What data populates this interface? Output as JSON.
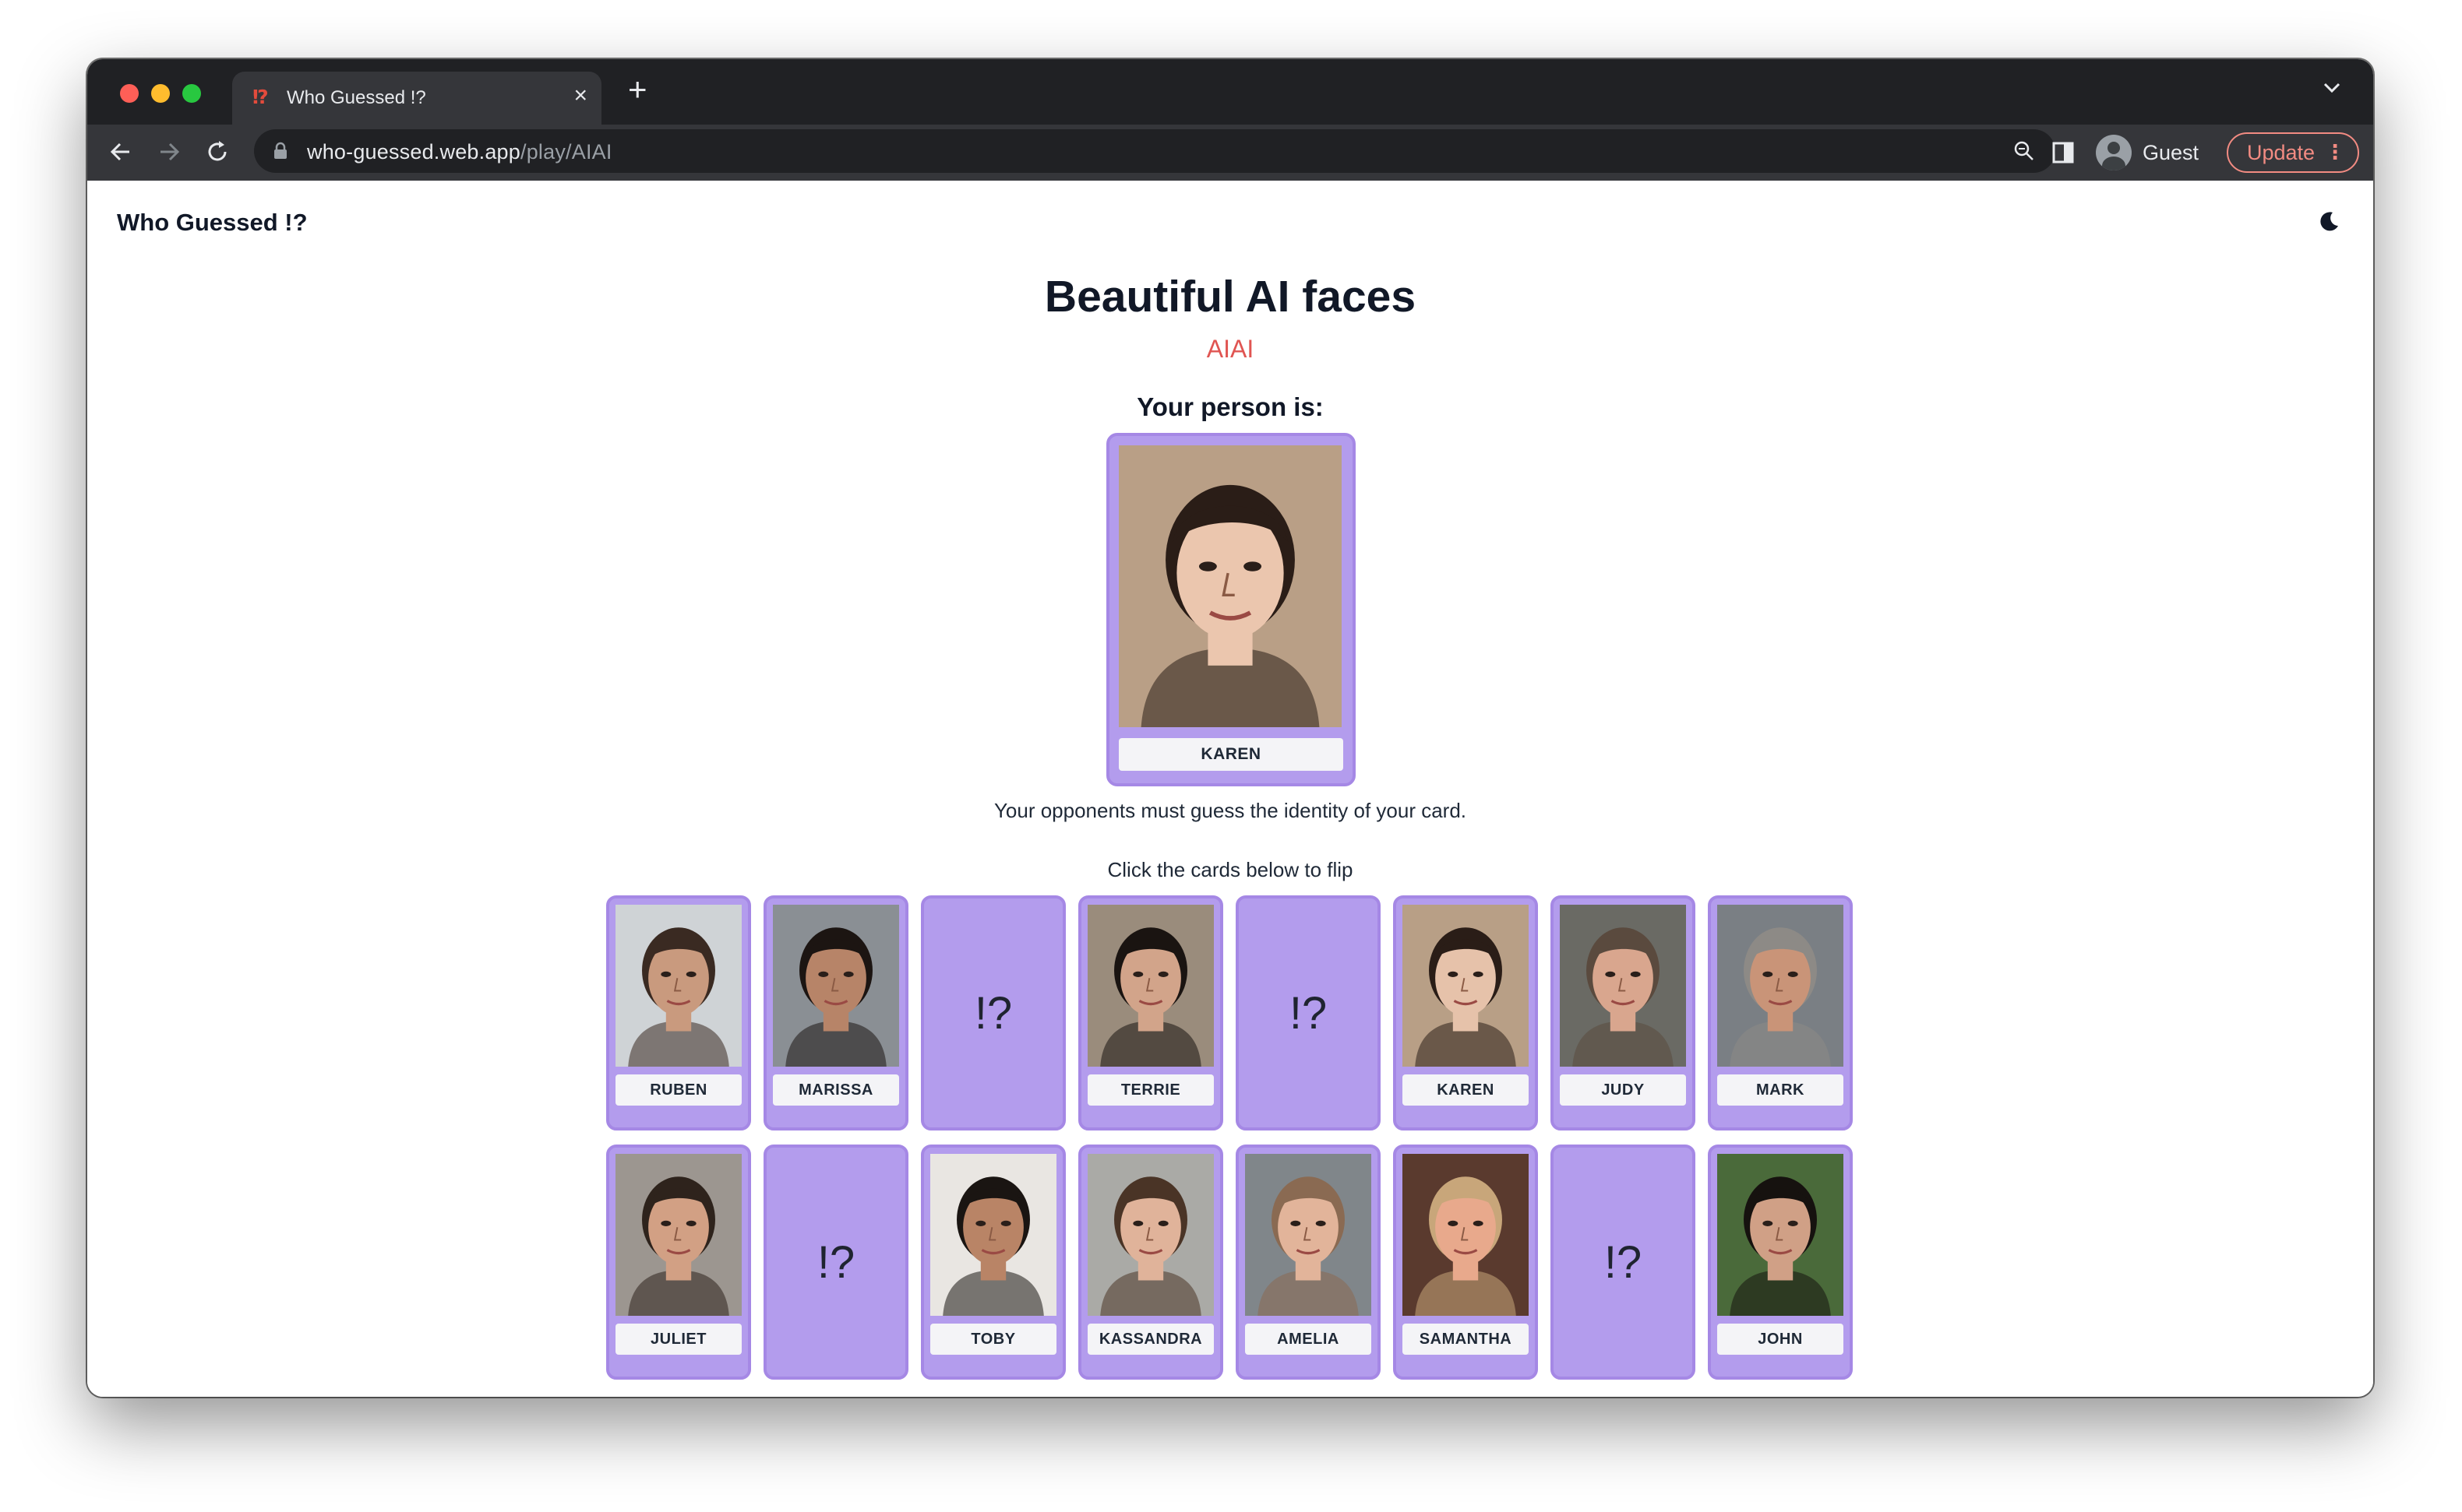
{
  "browser": {
    "tab_title": "Who Guessed !?",
    "tab_favicon": "⁉",
    "url_host": "who-guessed.web.app",
    "url_path": "/play/AIAI",
    "profile_label": "Guest",
    "update_label": "Update"
  },
  "header": {
    "brand": "Who Guessed !?",
    "theme_toggle_icon": "moon-icon"
  },
  "deck": {
    "title": "Beautiful AI faces",
    "code": "AIAI",
    "person_label": "Your person is:",
    "selected_name": "KAREN",
    "hint": "Your opponents must guess the identity of your card.",
    "instruction": "Click the cards below to flip",
    "back_mark": "!?"
  },
  "cards": [
    {
      "name": "RUBEN",
      "flipped": false,
      "skin": "#c99a7e",
      "hair": "#3a2a22",
      "bg": "#cfd3d6"
    },
    {
      "name": "MARISSA",
      "flipped": false,
      "skin": "#b78468",
      "hair": "#1c1512",
      "bg": "#8a8f94"
    },
    {
      "name": "",
      "flipped": true
    },
    {
      "name": "TERRIE",
      "flipped": false,
      "skin": "#d2a48a",
      "hair": "#1a1411",
      "bg": "#9a8c7c"
    },
    {
      "name": "",
      "flipped": true
    },
    {
      "name": "KAREN",
      "flipped": false,
      "skin": "#e6c2aa",
      "hair": "#2a1d17",
      "bg": "#b89f86"
    },
    {
      "name": "JUDY",
      "flipped": false,
      "skin": "#d9a68e",
      "hair": "#5a4a3e",
      "bg": "#6a6a64"
    },
    {
      "name": "MARK",
      "flipped": false,
      "skin": "#c99478",
      "hair": "#8d8a86",
      "bg": "#7a7f84"
    },
    {
      "name": "JULIET",
      "flipped": false,
      "skin": "#d2a084",
      "hair": "#2e231c",
      "bg": "#9c9690"
    },
    {
      "name": "",
      "flipped": true
    },
    {
      "name": "TOBY",
      "flipped": false,
      "skin": "#b98466",
      "hair": "#1a1512",
      "bg": "#e9e6e2"
    },
    {
      "name": "KASSANDRA",
      "flipped": false,
      "skin": "#e0b39a",
      "hair": "#4a3426",
      "bg": "#aaaaa6"
    },
    {
      "name": "AMELIA",
      "flipped": false,
      "skin": "#e2b49a",
      "hair": "#8a6a52",
      "bg": "#80868a"
    },
    {
      "name": "SAMANTHA",
      "flipped": false,
      "skin": "#e8a98c",
      "hair": "#c8a67a",
      "bg": "#5a3a2e"
    },
    {
      "name": "",
      "flipped": true
    },
    {
      "name": "JOHN",
      "flipped": false,
      "skin": "#d0a086",
      "hair": "#16120f",
      "bg": "#4a6a3a"
    }
  ],
  "main_portrait": {
    "skin": "#ebc6ae",
    "hair": "#2a1d17",
    "bg": "#b99f86"
  },
  "colors": {
    "card_fill": "#b39ced",
    "card_border": "#a588e5",
    "code_accent": "#e05552"
  }
}
